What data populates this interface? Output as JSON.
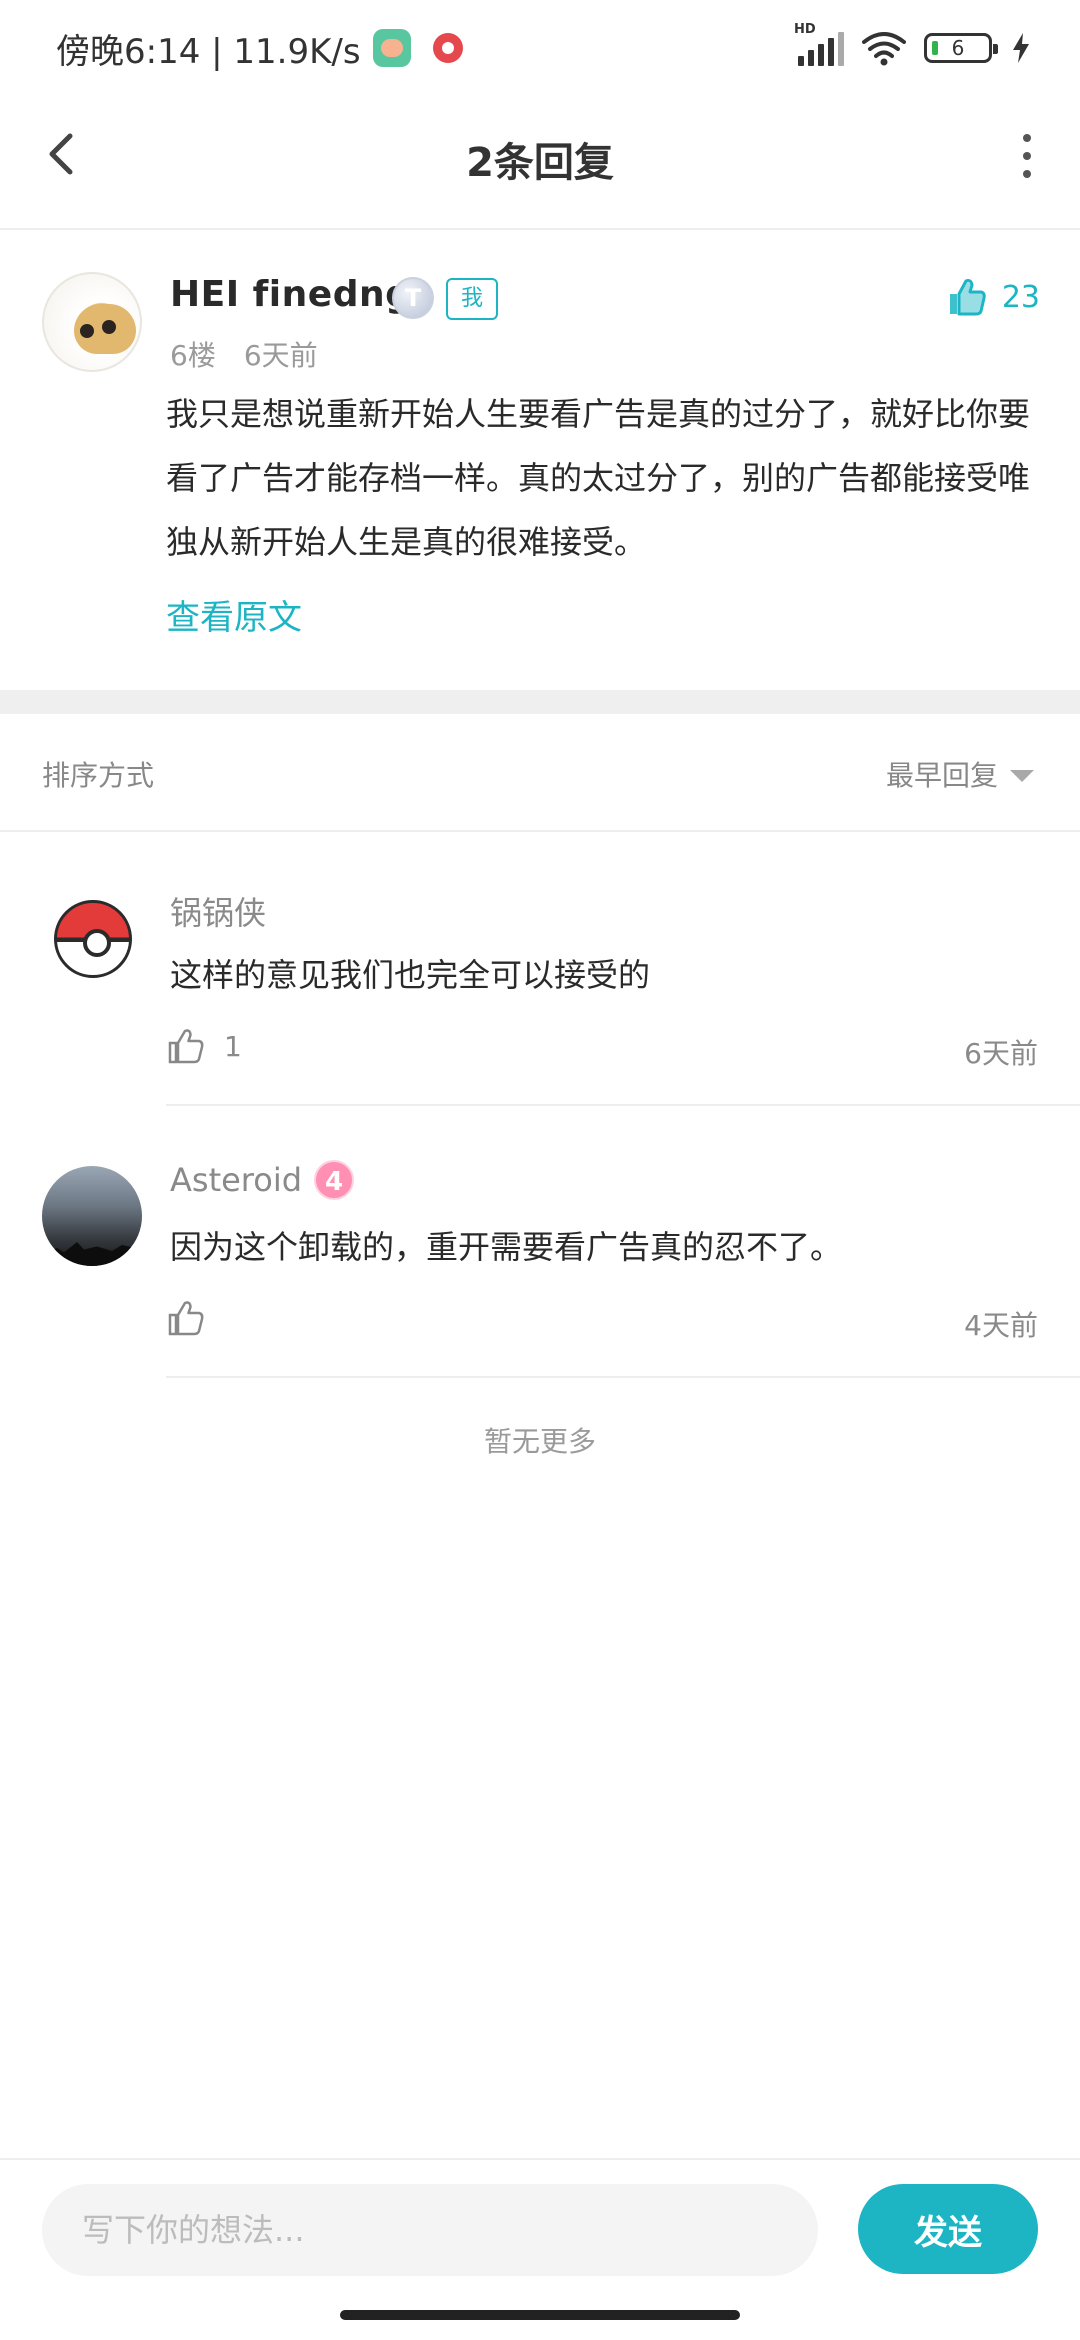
{
  "status_bar": {
    "time": "傍晚6:14 | 11.9K/s",
    "network_label": "HD",
    "battery": "6"
  },
  "header": {
    "title": "2条回复"
  },
  "main_comment": {
    "author": "HEI  finedng",
    "level_badge": "T",
    "me_badge": "我",
    "floor": "6楼",
    "time": "6天前",
    "likes": "23",
    "text": "我只是想说重新开始人生要看广告是真的过分了，就好比你要看了广告才能存档一样。真的太过分了，别的广告都能接受唯独从新开始人生是真的很难接受。",
    "view_original": "查看原文",
    "accent_color": "#1db5c4"
  },
  "sort": {
    "label": "排序方式",
    "selected": "最早回复"
  },
  "replies": [
    {
      "author": "锅锅侠",
      "avatar": "pokeball-avatar",
      "text": "这样的意见我们也完全可以接受的",
      "likes": "1",
      "time": "6天前"
    },
    {
      "author": "Asteroid",
      "level": "4",
      "avatar": "sky-avatar",
      "text": "因为这个卸载的，重开需要看广告真的忍不了。",
      "likes": "",
      "time": "4天前"
    }
  ],
  "footer_note": "暂无更多",
  "input": {
    "placeholder": "写下你的想法...",
    "send_label": "发送"
  }
}
